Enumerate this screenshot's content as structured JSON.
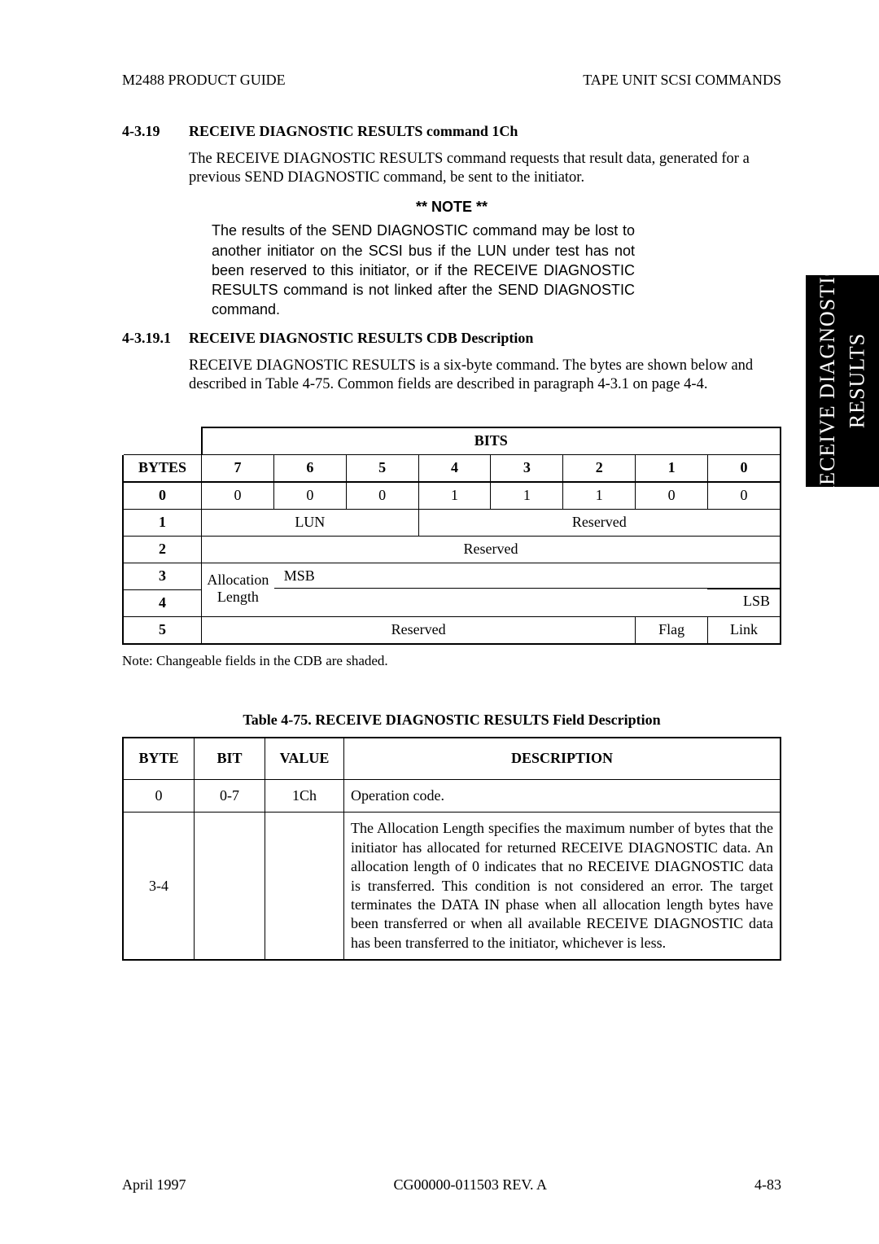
{
  "header": {
    "left": "M2488 PRODUCT GUIDE",
    "right": "TAPE UNIT SCSI COMMANDS"
  },
  "section1": {
    "num": "4-3.19",
    "title": "RECEIVE DIAGNOSTIC RESULTS command 1Ch",
    "para": "The RECEIVE DIAGNOSTIC RESULTS command requests that result data, generated for a previous SEND DIAGNOSTIC command, be sent to the initiator."
  },
  "note": {
    "head": "** NOTE **",
    "body": "The results of the SEND DIAGNOSTIC command may be lost to another initiator on the SCSI bus if the LUN under test has not been reserved to this initiator, or if the RECEIVE DIAGNOSTIC RESULTS command is not linked after the SEND DIAGNOSTIC command."
  },
  "section2": {
    "num": "4-3.19.1",
    "title": "RECEIVE DIAGNOSTIC RESULTS CDB Description",
    "para": "RECEIVE DIAGNOSTIC RESULTS is a six-byte command. The bytes are shown below and described in Table 4-75. Common fields are described in paragraph 4-3.1 on page 4-4."
  },
  "cdb": {
    "bits_label": "BITS",
    "bytes_label": "BYTES",
    "bits": [
      "7",
      "6",
      "5",
      "4",
      "3",
      "2",
      "1",
      "0"
    ],
    "row0": {
      "byte": "0",
      "cells": [
        "0",
        "0",
        "0",
        "1",
        "1",
        "1",
        "0",
        "0"
      ]
    },
    "row1": {
      "byte": "1",
      "lun": "LUN",
      "reserved": "Reserved"
    },
    "row2": {
      "byte": "2",
      "reserved": "Reserved"
    },
    "row3": {
      "byte": "3",
      "msb": "MSB"
    },
    "row4": {
      "byte": "4",
      "alloc": "Allocation Length",
      "lsb": "LSB"
    },
    "row5": {
      "byte": "5",
      "reserved": "Reserved",
      "flag": "Flag",
      "link": "Link"
    },
    "note": "Note: Changeable fields in the CDB are shaded."
  },
  "field_table": {
    "caption": "Table 4-75.   RECEIVE DIAGNOSTIC RESULTS Field Description",
    "headers": [
      "BYTE",
      "BIT",
      "VALUE",
      "DESCRIPTION"
    ],
    "rows": [
      {
        "byte": "0",
        "bit": "0-7",
        "value": "1Ch",
        "desc": "Operation code."
      },
      {
        "byte": "3-4",
        "bit": "",
        "value": "",
        "desc": "The Allocation Length specifies the maximum number of bytes that the initiator has allocated for returned RECEIVE DIAGNOSTIC data. An allocation length of 0 indicates that no RECEIVE DIAGNOSTIC data is transferred. This condition is not considered an error. The target terminates the DATA IN phase when all allocation length bytes have been transferred or when all available RECEIVE DIAGNOSTIC data has been transferred to the initiator, whichever is less."
      }
    ]
  },
  "footer": {
    "left": "April 1997",
    "center": "CG00000-011503 REV. A",
    "right": "4-83"
  },
  "side_tab": {
    "line1": "RECEIVE DIAGNOSTIC",
    "line2": "RESULTS"
  }
}
